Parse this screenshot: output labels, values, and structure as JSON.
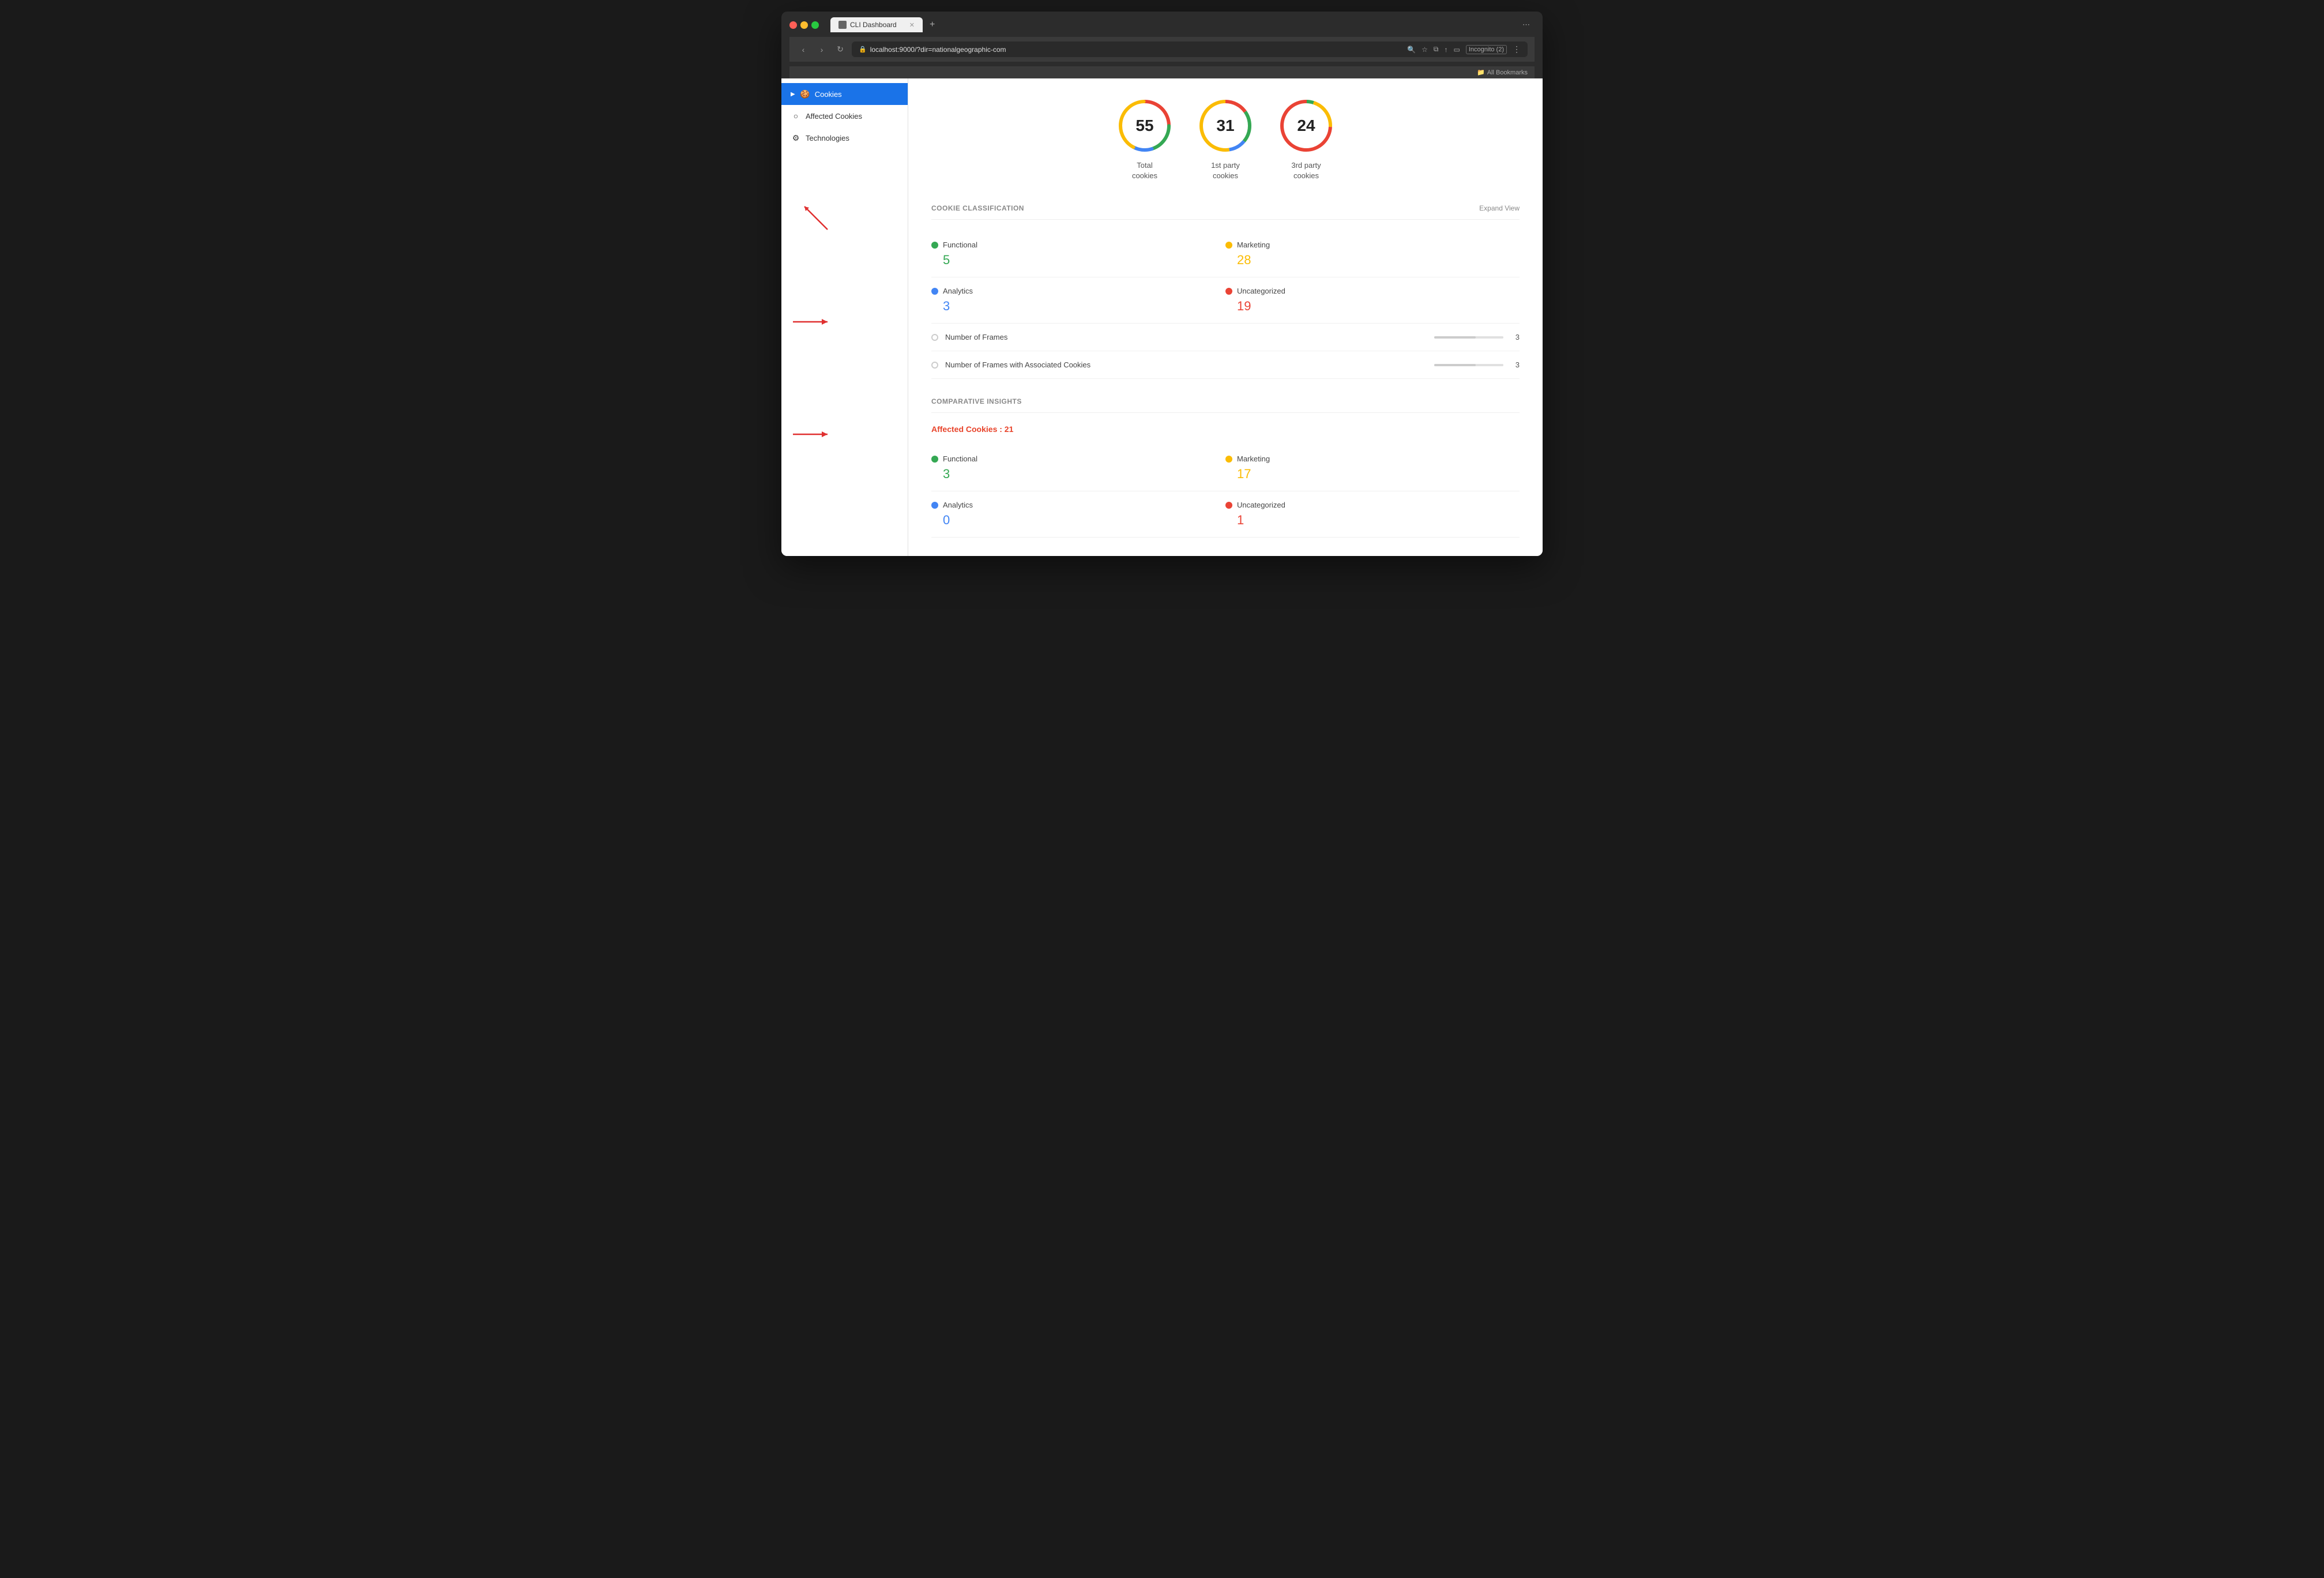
{
  "browser": {
    "tab_title": "CLI Dashboard",
    "url": "localhost:9000/?dir=nationalgeographic-com",
    "new_tab_label": "+",
    "bookmarks_label": "All Bookmarks",
    "incognito_label": "Incognito (2)"
  },
  "sidebar": {
    "items": [
      {
        "id": "cookies",
        "label": "Cookies",
        "icon": "🍪",
        "active": true
      },
      {
        "id": "affected-cookies",
        "label": "Affected Cookies",
        "icon": "○",
        "active": false
      },
      {
        "id": "technologies",
        "label": "Technologies",
        "icon": "⚙",
        "active": false
      }
    ]
  },
  "stats": [
    {
      "id": "total",
      "value": "55",
      "label": "Total\ncookies",
      "color1": "#ea4335",
      "color2": "#34a853",
      "color3": "#4285f4",
      "color4": "#fbbc04"
    },
    {
      "id": "first-party",
      "value": "31",
      "label": "1st party\ncookies",
      "color1": "#ea4335",
      "color2": "#34a853",
      "color3": "#4285f4",
      "color4": "#fbbc04"
    },
    {
      "id": "third-party",
      "value": "24",
      "label": "3rd party\ncookies",
      "color1": "#34a853",
      "color2": "#fbbc04",
      "color3": "#ea4335",
      "color4": "#4285f4"
    }
  ],
  "cookie_classification": {
    "section_title": "COOKIE CLASSIFICATION",
    "expand_label": "Expand View",
    "items": [
      {
        "id": "functional",
        "name": "Functional",
        "count": "5",
        "dot": "green",
        "count_class": "count-green"
      },
      {
        "id": "marketing",
        "name": "Marketing",
        "count": "28",
        "dot": "orange",
        "count_class": "count-orange"
      },
      {
        "id": "analytics",
        "name": "Analytics",
        "count": "3",
        "dot": "blue",
        "count_class": "count-blue"
      },
      {
        "id": "uncategorized",
        "name": "Uncategorized",
        "count": "19",
        "dot": "red",
        "count_class": "count-red"
      }
    ],
    "frame_items": [
      {
        "id": "num-frames",
        "label": "Number of Frames",
        "count": "3"
      },
      {
        "id": "num-frames-cookies",
        "label": "Number of Frames with Associated Cookies",
        "count": "3"
      }
    ]
  },
  "comparative_insights": {
    "section_title": "COMPARATIVE INSIGHTS",
    "affected_cookies_label": "Affected Cookies : 21",
    "items": [
      {
        "id": "functional",
        "name": "Functional",
        "count": "3",
        "dot": "green",
        "count_class": "count-green"
      },
      {
        "id": "marketing",
        "name": "Marketing",
        "count": "17",
        "dot": "orange",
        "count_class": "count-orange"
      },
      {
        "id": "analytics",
        "name": "Analytics",
        "count": "0",
        "dot": "blue",
        "count_class": "count-blue"
      },
      {
        "id": "uncategorized",
        "name": "Uncategorized",
        "count": "1",
        "dot": "red",
        "count_class": "count-red"
      }
    ]
  }
}
